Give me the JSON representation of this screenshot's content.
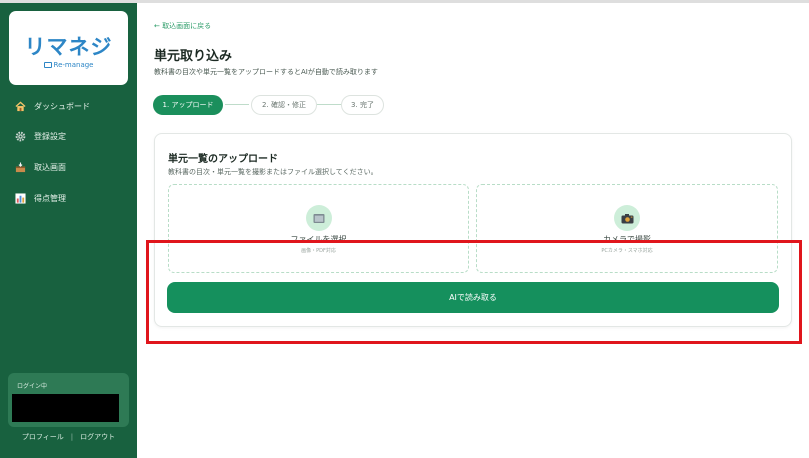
{
  "sidebar": {
    "logo": {
      "text": "リマネジ",
      "sub": "Re-manage"
    },
    "nav": [
      {
        "label": "ダッシュボード",
        "icon": "home-icon"
      },
      {
        "label": "登録設定",
        "icon": "gear-icon"
      },
      {
        "label": "取込画面",
        "icon": "inbox-icon"
      },
      {
        "label": "得点管理",
        "icon": "bar-chart-icon"
      }
    ],
    "login": {
      "label": "ログイン中",
      "name": ""
    },
    "footer": {
      "profile": "プロフィール",
      "separator": "|",
      "logout": "ログアウト"
    }
  },
  "main": {
    "back_link": "← 取込画面に戻る",
    "title": "単元取り込み",
    "description": "教科書の目次や単元一覧をアップロードするとAIが自動で読み取ります",
    "steps": [
      {
        "label": "1. アップロード",
        "active": true
      },
      {
        "label": "2. 確認・修正",
        "active": false
      },
      {
        "label": "3. 完了",
        "active": false
      }
    ],
    "card": {
      "title": "単元一覧のアップロード",
      "description": "教科書の目次・単元一覧を撮影またはファイル選択してください。",
      "file_upload": {
        "label": "ファイルを選択",
        "sub": "画像・PDF対応",
        "icon": "folder-icon"
      },
      "camera_upload": {
        "label": "カメラで撮影",
        "sub": "PCカメラ・スマホ対応",
        "icon": "camera-icon"
      },
      "ai_button": "AIで読み取る"
    }
  },
  "colors": {
    "sidebar_bg": "#18613f",
    "accent": "#15905d",
    "highlight": "#e0151c"
  }
}
